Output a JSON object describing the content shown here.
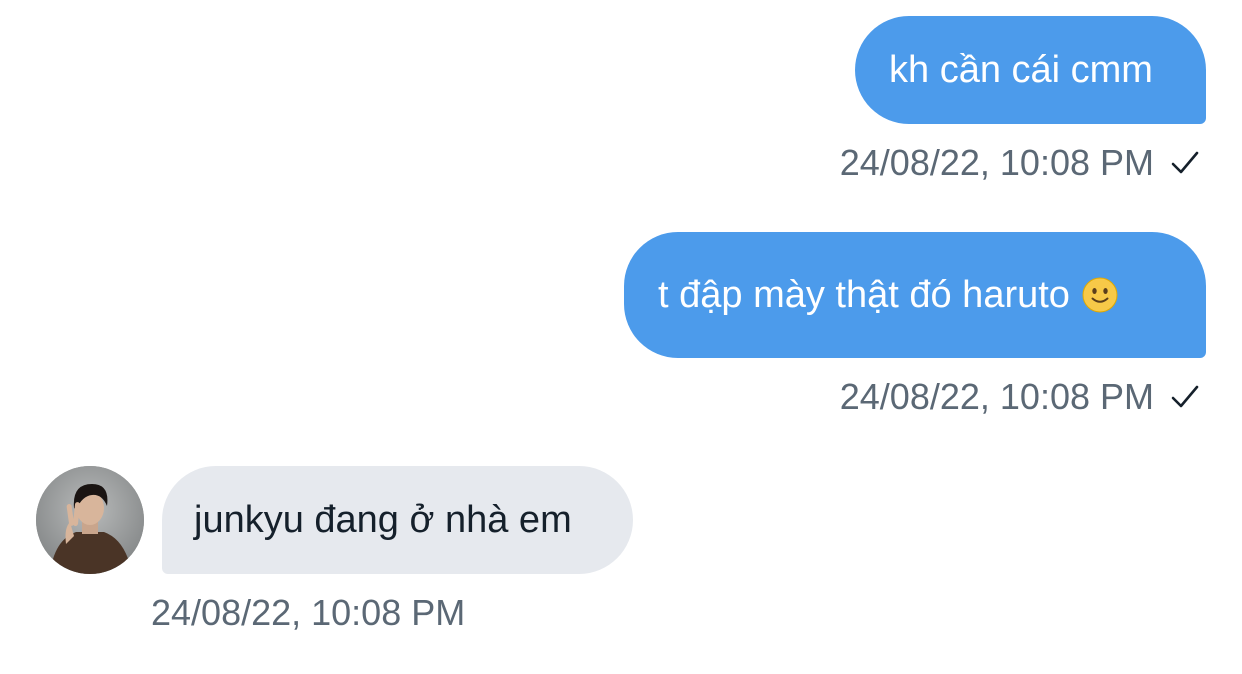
{
  "messages": [
    {
      "direction": "outgoing",
      "text": "kh cần cái cmm",
      "timestamp": "24/08/22, 10:08 PM",
      "status_icon": "check-icon"
    },
    {
      "direction": "outgoing",
      "text": "t đập mày thật đó haruto",
      "emoji": "slightly-smiling-face",
      "timestamp": "24/08/22, 10:08 PM",
      "status_icon": "check-icon"
    },
    {
      "direction": "incoming",
      "text": "junkyu đang ở nhà em",
      "timestamp": "24/08/22, 10:08 PM",
      "avatar_icon": "contact-avatar"
    }
  ],
  "colors": {
    "outgoing_bubble": "#4c9beb",
    "incoming_bubble": "#e6e9ee",
    "timestamp_text": "#5b6875"
  }
}
